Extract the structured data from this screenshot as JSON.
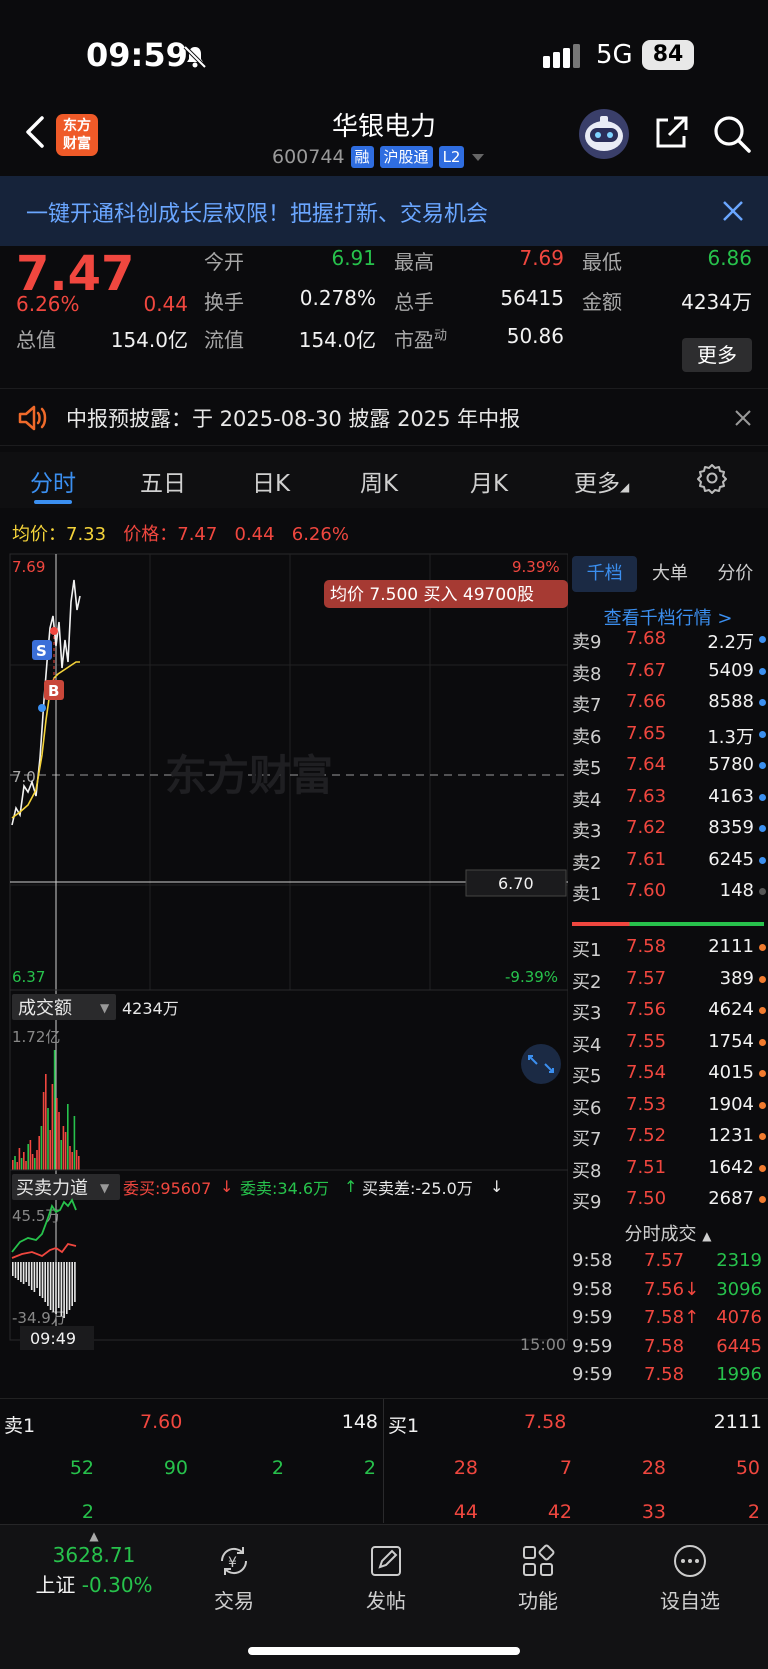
{
  "status_bar": {
    "time": "09:59",
    "network": "5G",
    "battery": "84"
  },
  "header": {
    "logo": "东方财富",
    "stock_name": "华银电力",
    "stock_code": "600744",
    "tags": [
      "融",
      "沪股通",
      "L2"
    ]
  },
  "banner": {
    "text": "一键开通科创成长层权限！把握打新、交易机会"
  },
  "quote": {
    "price": "7.47",
    "change_pct": "6.26%",
    "change": "0.44",
    "market_cap_label": "总值",
    "market_cap": "154.0亿",
    "fields": [
      {
        "label": "今开",
        "value": "6.91",
        "color": "green"
      },
      {
        "label": "最高",
        "value": "7.69",
        "color": "red"
      },
      {
        "label": "最低",
        "value": "6.86",
        "color": "green"
      },
      {
        "label": "换手",
        "value": "0.278%",
        "color": "white"
      },
      {
        "label": "总手",
        "value": "56415",
        "color": "white"
      },
      {
        "label": "金额",
        "value": "4234万",
        "color": "white"
      },
      {
        "label": "流值",
        "value": "154.0亿",
        "color": "white"
      },
      {
        "label": "市盈",
        "sup": "动",
        "value": "50.86",
        "color": "white"
      }
    ],
    "more_label": "更多"
  },
  "notice": {
    "text": "中报预披露：于 2025-08-30 披露 2025 年中报"
  },
  "tabs": [
    "分时",
    "五日",
    "日K",
    "周K",
    "月K",
    "更多"
  ],
  "avg_row": {
    "avg_label": "均价：",
    "avg_value": "7.33",
    "price_label": "价格：",
    "price_value": "7.47",
    "change": "0.44",
    "change_pct": "6.26%"
  },
  "chart": {
    "watermark": "东方财富",
    "y_max": "7.69",
    "y_min": "6.37",
    "pct_max": "9.39%",
    "pct_min": "-9.39%",
    "mid_label": "7.0",
    "crosshair_price": "6.70",
    "trade_tooltip": "均价 7.500 买入 49700股",
    "marker_sell": "S",
    "marker_buy": "B",
    "volume_label": "成交额",
    "volume_value": "4234万",
    "volume_max": "1.72亿",
    "force_label": "买卖力道",
    "force_buy": "委买:95607",
    "force_sell": "委卖:34.6万",
    "force_diff": "买卖差:-25.0万",
    "force_max": "45.5万",
    "force_min": "-34.9万",
    "time_cursor": "09:49",
    "time_end": "15:00"
  },
  "orderbook": {
    "tabs": [
      "千档",
      "大单",
      "分价"
    ],
    "link": "查看千档行情 >",
    "asks": [
      {
        "label": "卖9",
        "price": "7.68",
        "vol": "2.2万",
        "dot": "#3b8ff0"
      },
      {
        "label": "卖8",
        "price": "7.67",
        "vol": "5409",
        "dot": "#3b8ff0"
      },
      {
        "label": "卖7",
        "price": "7.66",
        "vol": "8588",
        "dot": "#3b8ff0"
      },
      {
        "label": "卖6",
        "price": "7.65",
        "vol": "1.3万",
        "dot": "#3b8ff0"
      },
      {
        "label": "卖5",
        "price": "7.64",
        "vol": "5780",
        "dot": "#3b8ff0"
      },
      {
        "label": "卖4",
        "price": "7.63",
        "vol": "4163",
        "dot": "#3b8ff0"
      },
      {
        "label": "卖3",
        "price": "7.62",
        "vol": "8359",
        "dot": "#3b8ff0"
      },
      {
        "label": "卖2",
        "price": "7.61",
        "vol": "6245",
        "dot": "#3b8ff0"
      },
      {
        "label": "卖1",
        "price": "7.60",
        "vol": "148",
        "dot": "#555555"
      }
    ],
    "bids": [
      {
        "label": "买1",
        "price": "7.58",
        "vol": "2111",
        "dot": "#f07a2e"
      },
      {
        "label": "买2",
        "price": "7.57",
        "vol": "389",
        "dot": "#f07a2e"
      },
      {
        "label": "买3",
        "price": "7.56",
        "vol": "4624",
        "dot": "#f07a2e"
      },
      {
        "label": "买4",
        "price": "7.55",
        "vol": "1754",
        "dot": "#f07a2e"
      },
      {
        "label": "买5",
        "price": "7.54",
        "vol": "4015",
        "dot": "#f07a2e"
      },
      {
        "label": "买6",
        "price": "7.53",
        "vol": "1904",
        "dot": "#f07a2e"
      },
      {
        "label": "买7",
        "price": "7.52",
        "vol": "1231",
        "dot": "#f07a2e"
      },
      {
        "label": "买8",
        "price": "7.51",
        "vol": "1642",
        "dot": "#f07a2e"
      },
      {
        "label": "买9",
        "price": "7.50",
        "vol": "2687",
        "dot": "#f07a2e"
      }
    ],
    "ticks_title": "分时成交",
    "ticks": [
      {
        "time": "9:58",
        "price": "7.57",
        "vol": "2319",
        "pc": "red",
        "vc": "green"
      },
      {
        "time": "9:58",
        "price": "7.56↓",
        "vol": "3096",
        "pc": "red",
        "vc": "green"
      },
      {
        "time": "9:59",
        "price": "7.58↑",
        "vol": "4076",
        "pc": "red",
        "vc": "red"
      },
      {
        "time": "9:59",
        "price": "7.58",
        "vol": "6445",
        "pc": "red",
        "vc": "red"
      },
      {
        "time": "9:59",
        "price": "7.58",
        "vol": "1996",
        "pc": "red",
        "vc": "green"
      }
    ]
  },
  "bidask": {
    "ask_label": "卖1",
    "ask_price": "7.60",
    "ask_vol": "148",
    "bid_label": "买1",
    "bid_price": "7.58",
    "bid_vol": "2111",
    "ask_queue": [
      "52",
      "90",
      "2",
      "2",
      "2"
    ],
    "bid_queue": [
      "28",
      "7",
      "28",
      "50",
      "44",
      "42",
      "33",
      "2"
    ]
  },
  "index": {
    "value": "3628.71",
    "name": "上证",
    "change": "-0.30%"
  },
  "bottom_nav": [
    "交易",
    "发帖",
    "功能",
    "设自选"
  ]
}
